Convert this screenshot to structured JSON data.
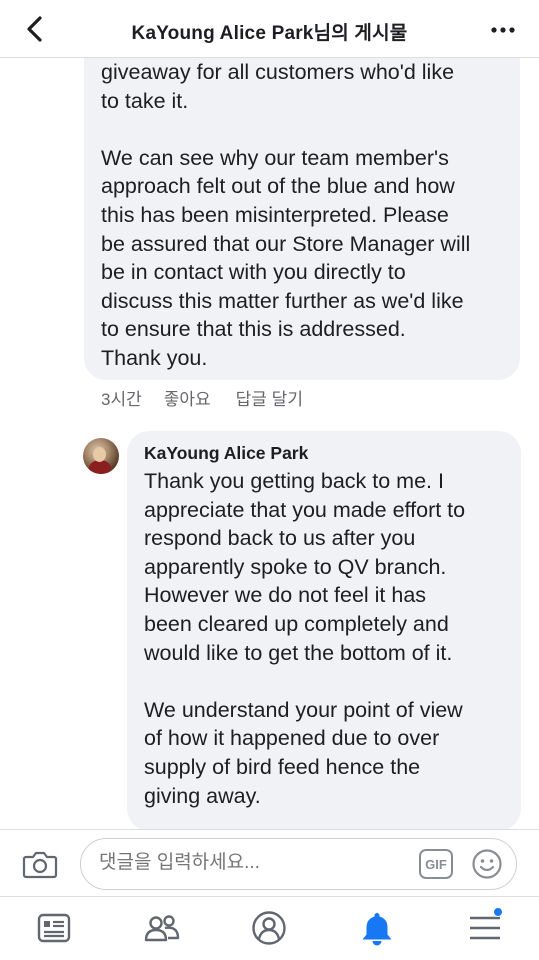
{
  "header": {
    "title": "KaYoung Alice Park님의 게시물"
  },
  "reply_comment": {
    "lines_para1": [
      "giveaway for all customers who'd like",
      "to take it."
    ],
    "lines_para2": [
      "We can see why our team member's",
      "approach felt out of the blue and how",
      "this has been misinterpreted. Please",
      "be assured that our Store Manager will",
      "be in contact with you directly to",
      "discuss this matter further as we'd like",
      "to ensure that this is addressed.",
      "Thank you."
    ],
    "time": "3시간",
    "like_label": "좋아요",
    "reply_label": "답글 달기"
  },
  "user_comment": {
    "author": "KaYoung Alice Park",
    "lines_para1": [
      "Thank you getting back to me. I",
      "appreciate that you made effort to",
      "respond back to us after you",
      "apparently spoke to QV branch.",
      "However we do not feel it has",
      "been cleared up completely and",
      "would like to get the bottom of it."
    ],
    "lines_para2": [
      "We understand your point of view",
      "of how it happened due to over",
      "supply of bird feed hence the",
      "giving away."
    ]
  },
  "composer": {
    "placeholder": "댓글을 입력하세요...",
    "gif_label": "GIF"
  },
  "colors": {
    "bubble": "#f0f2f5",
    "accent": "#1877f2",
    "muted": "#65676b"
  },
  "tabs": [
    "news-feed",
    "groups",
    "profile",
    "notifications",
    "menu"
  ]
}
